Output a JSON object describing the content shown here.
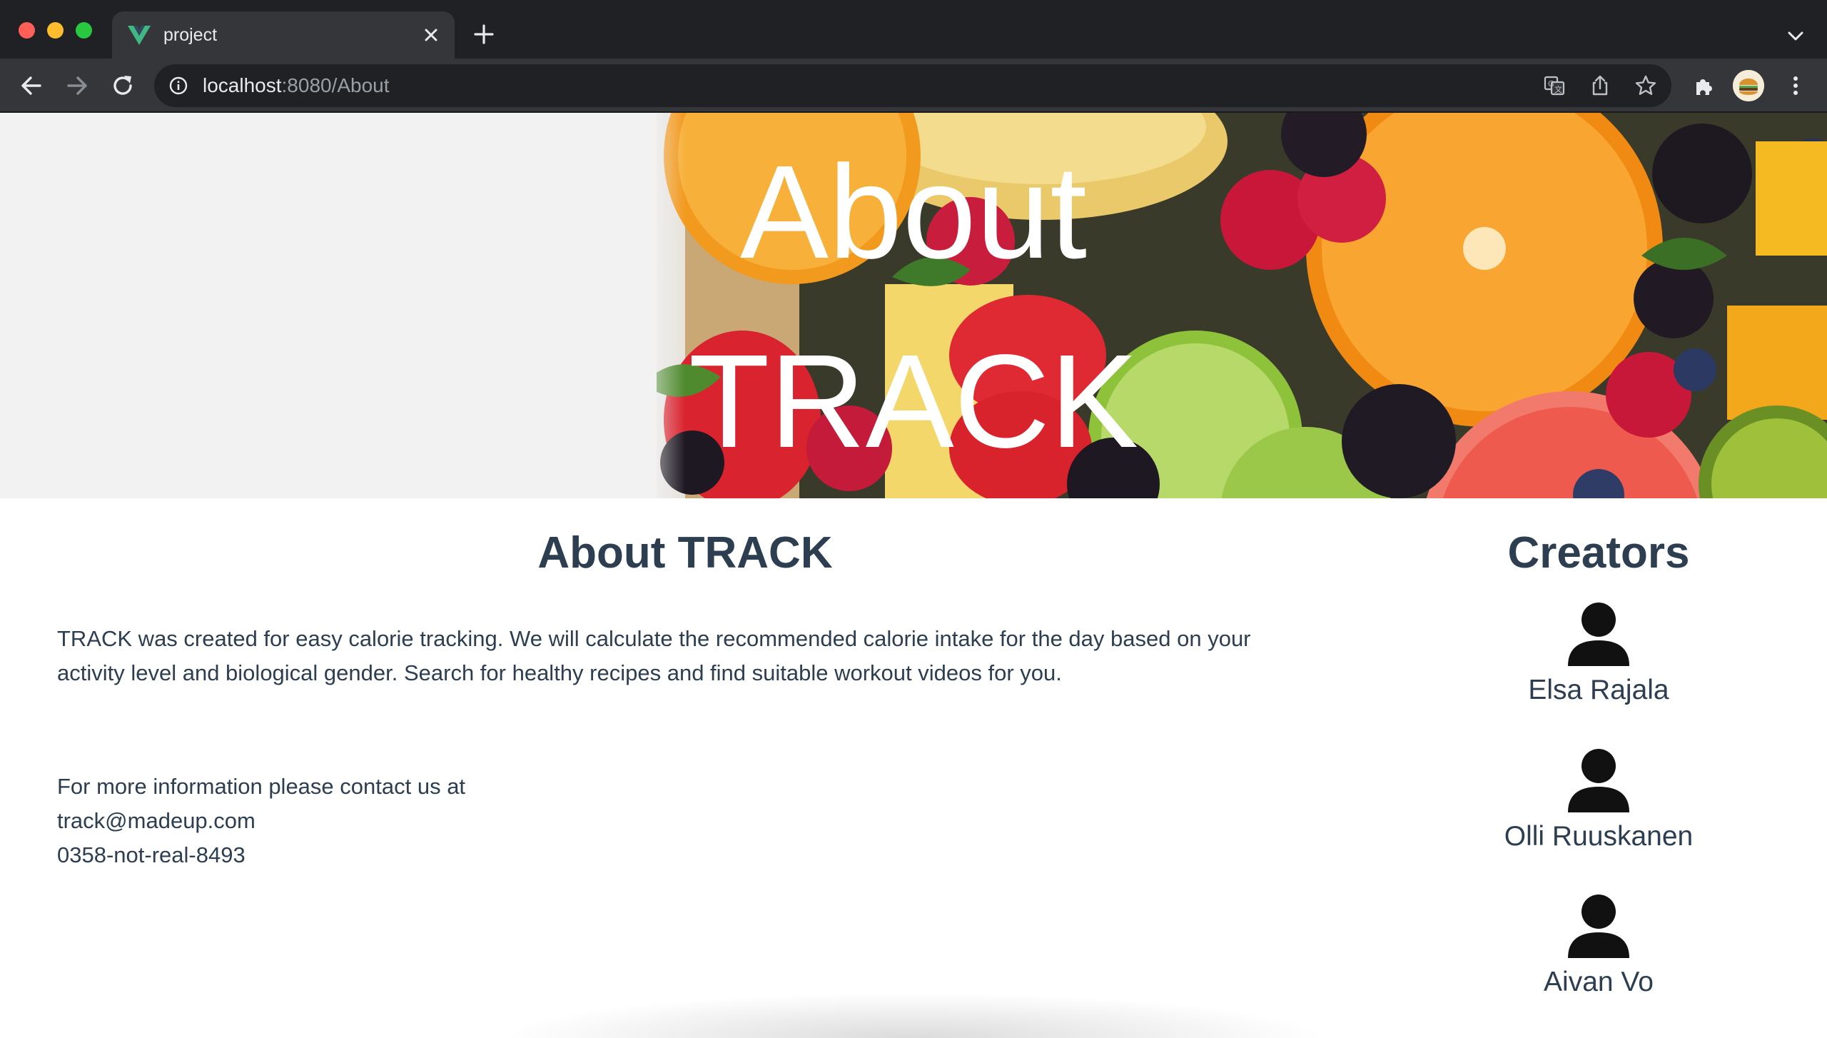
{
  "browser": {
    "tab_title": "project",
    "url_host": "localhost",
    "url_path": ":8080/About",
    "icons": [
      "vue-favicon-icon",
      "close-icon",
      "plus-icon",
      "chevron-down-icon",
      "back-icon",
      "forward-icon",
      "reload-icon",
      "info-icon",
      "translate-icon",
      "share-icon",
      "star-icon",
      "extensions-icon",
      "avatar",
      "kebab-menu-icon"
    ]
  },
  "hero": {
    "line1": "About",
    "line2": "TRACK"
  },
  "about": {
    "heading": "About TRACK",
    "line1": "TRACK was created for easy calorie tracking. We will calculate the recommended calorie intake for the day based on your",
    "line2": "activity level and biological gender. Search for healthy recipes and find suitable workout videos for you.",
    "contact_intro": "For more information please contact us at",
    "email": "track@madeup.com",
    "phone": "0358-not-real-8493"
  },
  "creators": {
    "heading": "Creators",
    "people": [
      {
        "name": "Elsa Rajala",
        "icon": "person-icon"
      },
      {
        "name": "Olli Ruuskanen",
        "icon": "person-icon"
      },
      {
        "name": "Aivan Vo",
        "icon": "person-icon"
      }
    ]
  },
  "colors": {
    "text": "#2c3e50",
    "chrome_dark": "#202124",
    "chrome_toolbar": "#35363a",
    "vue_green": "#41b883"
  }
}
